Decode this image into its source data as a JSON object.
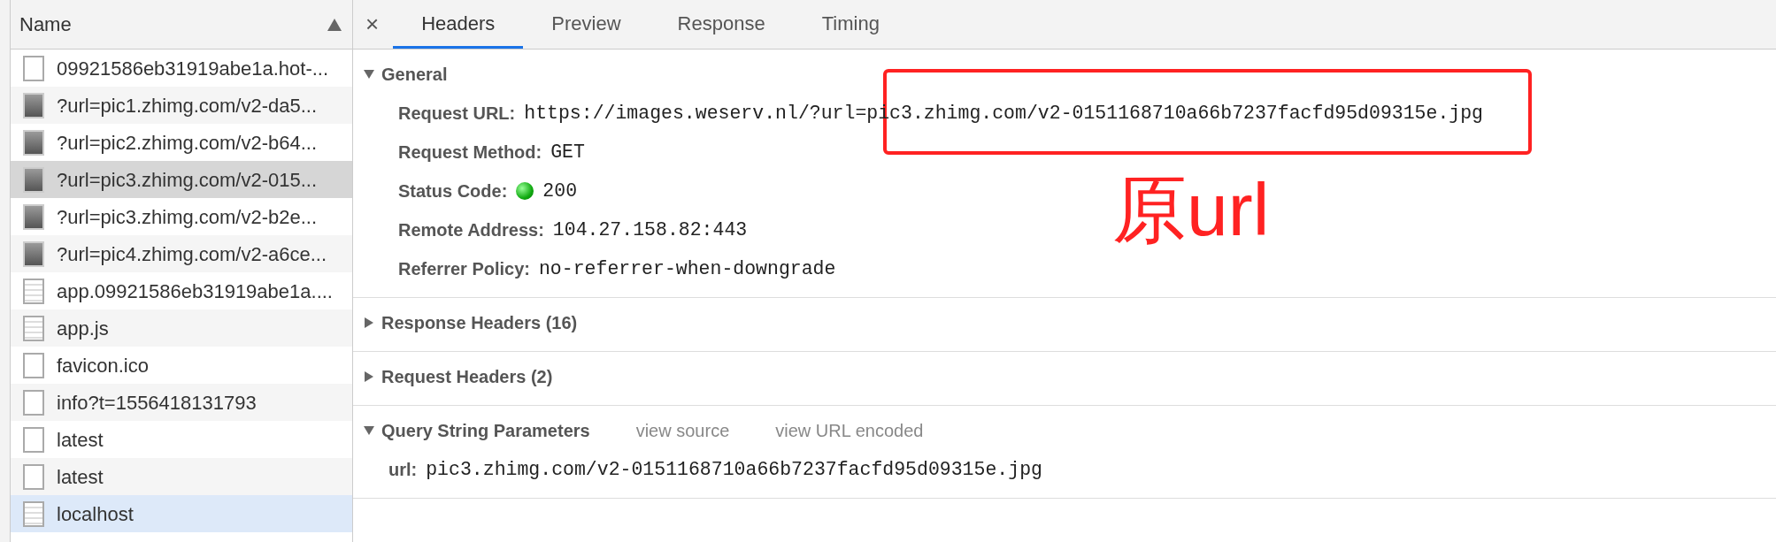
{
  "request_list": {
    "column": "Name",
    "rows": [
      {
        "name": "09921586eb31919abe1a.hot-...",
        "kind": "blank",
        "selected": false,
        "hovered": false
      },
      {
        "name": "?url=pic1.zhimg.com/v2-da5...",
        "kind": "image",
        "selected": false,
        "hovered": false
      },
      {
        "name": "?url=pic2.zhimg.com/v2-b64...",
        "kind": "image",
        "selected": false,
        "hovered": false
      },
      {
        "name": "?url=pic3.zhimg.com/v2-015...",
        "kind": "image",
        "selected": true,
        "hovered": false
      },
      {
        "name": "?url=pic3.zhimg.com/v2-b2e...",
        "kind": "image",
        "selected": false,
        "hovered": false
      },
      {
        "name": "?url=pic4.zhimg.com/v2-a6ce...",
        "kind": "image",
        "selected": false,
        "hovered": false
      },
      {
        "name": "app.09921586eb31919abe1a....",
        "kind": "document",
        "selected": false,
        "hovered": false
      },
      {
        "name": "app.js",
        "kind": "document",
        "selected": false,
        "hovered": false
      },
      {
        "name": "favicon.ico",
        "kind": "blank",
        "selected": false,
        "hovered": false
      },
      {
        "name": "info?t=1556418131793",
        "kind": "blank",
        "selected": false,
        "hovered": false
      },
      {
        "name": "latest",
        "kind": "blank",
        "selected": false,
        "hovered": false
      },
      {
        "name": "latest",
        "kind": "blank",
        "selected": false,
        "hovered": false
      },
      {
        "name": "localhost",
        "kind": "document",
        "selected": false,
        "hovered": true
      }
    ]
  },
  "detail": {
    "close": "×",
    "tabs": [
      {
        "label": "Headers",
        "selected": true
      },
      {
        "label": "Preview",
        "selected": false
      },
      {
        "label": "Response",
        "selected": false
      },
      {
        "label": "Timing",
        "selected": false
      }
    ],
    "sections": [
      {
        "title": "General",
        "expanded": true,
        "fields": [
          {
            "label": "Request URL:",
            "value": "https://images.weserv.nl/?url=pic3.zhimg.com/v2-0151168710a66b7237facfd95d09315e.jpg",
            "kind": "text"
          },
          {
            "label": "Request Method:",
            "value": "GET",
            "kind": "text"
          },
          {
            "label": "Status Code:",
            "value": "200",
            "kind": "status"
          },
          {
            "label": "Remote Address:",
            "value": "104.27.158.82:443",
            "kind": "text"
          },
          {
            "label": "Referrer Policy:",
            "value": "no-referrer-when-downgrade",
            "kind": "text"
          }
        ]
      },
      {
        "title": "Response Headers (16)",
        "expanded": false
      },
      {
        "title": "Request Headers (2)",
        "expanded": false
      },
      {
        "title": "Query String Parameters",
        "expanded": true,
        "links": [
          "view source",
          "view URL encoded"
        ],
        "fields": [
          {
            "label": "url:",
            "value": "pic3.zhimg.com/v2-0151168710a66b7237facfd95d09315e.jpg",
            "kind": "text"
          }
        ]
      }
    ]
  },
  "annotation": {
    "text": "原url"
  }
}
